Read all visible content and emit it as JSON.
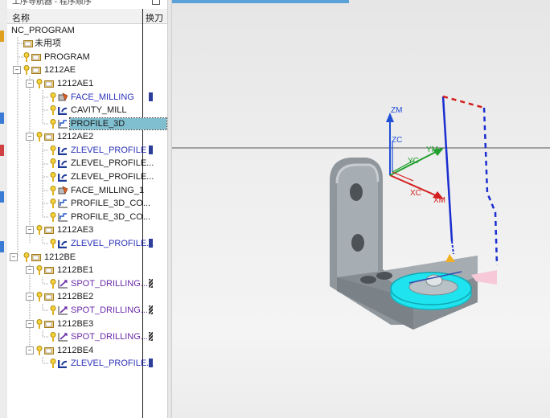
{
  "navigator": {
    "title": "工序导航器 - 程序顺序",
    "col_name": "名称",
    "col_toolchange": "换刀",
    "rows": [
      {
        "label": "NC_PROGRAM"
      },
      {
        "label": "未用项"
      },
      {
        "label": "PROGRAM"
      },
      {
        "label": "1212AE"
      },
      {
        "label": "1212AE1"
      },
      {
        "label": "FACE_MILLING"
      },
      {
        "label": "CAVITY_MILL"
      },
      {
        "label": "PROFILE_3D"
      },
      {
        "label": "1212AE2"
      },
      {
        "label": "ZLEVEL_PROFILE"
      },
      {
        "label": "ZLEVEL_PROFILE..."
      },
      {
        "label": "ZLEVEL_PROFILE..."
      },
      {
        "label": "FACE_MILLING_1"
      },
      {
        "label": "PROFILE_3D_CO..."
      },
      {
        "label": "PROFILE_3D_CO..."
      },
      {
        "label": "1212AE3"
      },
      {
        "label": "ZLEVEL_PROFILE..."
      },
      {
        "label": "1212BE"
      },
      {
        "label": "1212BE1"
      },
      {
        "label": "SPOT_DRILLING..."
      },
      {
        "label": "1212BE2"
      },
      {
        "label": "SPOT_DRILLING..."
      },
      {
        "label": "1212BE3"
      },
      {
        "label": "SPOT_DRILLING..."
      },
      {
        "label": "1212BE4"
      },
      {
        "label": "ZLEVEL_PROFILE..."
      }
    ]
  },
  "viewport": {
    "axes": {
      "zm": "ZM",
      "zc": "ZC",
      "yc": "YC",
      "ym": "YM",
      "xc": "XC",
      "xm": "XM"
    }
  },
  "colors": {
    "selection": "#7fbfd0",
    "operation_text": "#2b32b8",
    "drill_text": "#6a2aa8",
    "tool_highlight": "#1fe3ee"
  }
}
